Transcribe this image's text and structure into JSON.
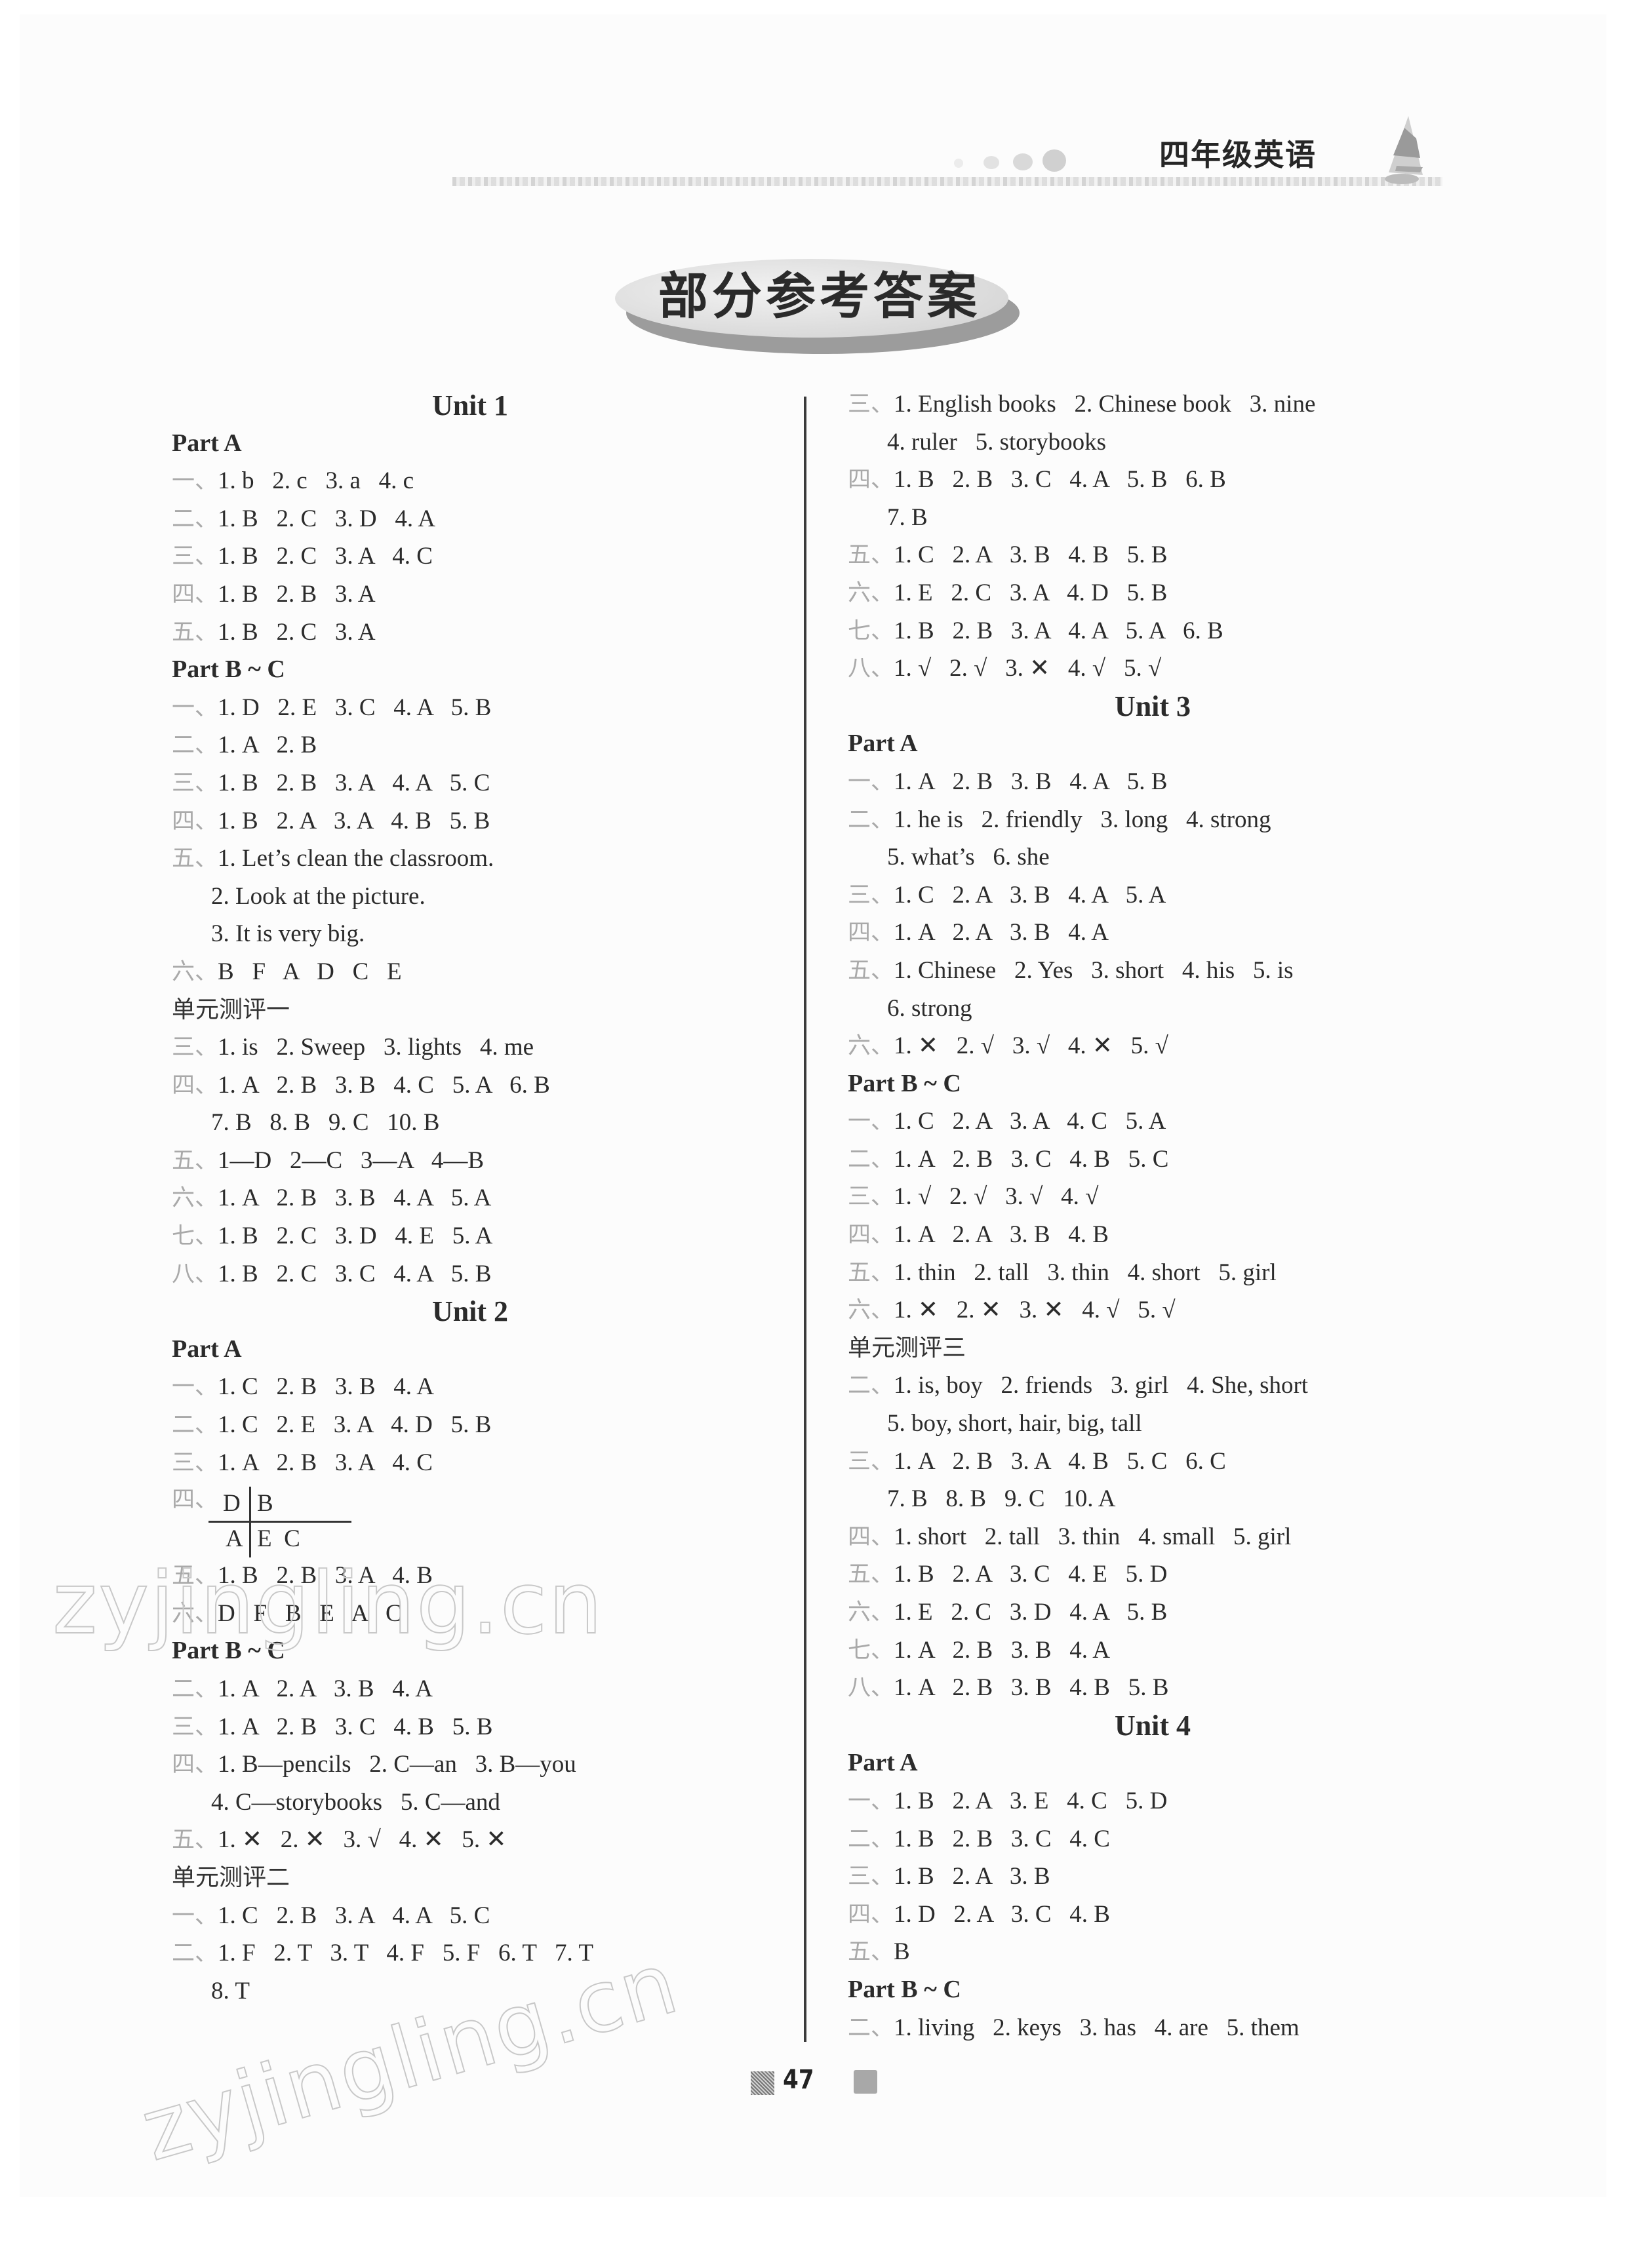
{
  "header": {
    "title": "四年级英语",
    "icon": "sailboat-icon"
  },
  "badge_title": "部分参考答案",
  "page_number": "47",
  "watermark": "zyjingling.cn",
  "left_column": [
    {
      "type": "unit",
      "text": "Unit 1"
    },
    {
      "type": "part",
      "text": "Part A"
    },
    {
      "type": "ans",
      "num": "一、",
      "text": "1. b   2. c   3. a   4. c"
    },
    {
      "type": "ans",
      "num": "二、",
      "text": "1. B   2. C   3. D   4. A"
    },
    {
      "type": "ans",
      "num": "三、",
      "text": "1. B   2. C   3. A   4. C"
    },
    {
      "type": "ans",
      "num": "四、",
      "text": "1. B   2. B   3. A"
    },
    {
      "type": "ans",
      "num": "五、",
      "text": "1. B   2. C   3. A"
    },
    {
      "type": "part",
      "text": "Part B ~ C"
    },
    {
      "type": "ans",
      "num": "一、",
      "text": "1. D   2. E   3. C   4. A   5. B"
    },
    {
      "type": "ans",
      "num": "二、",
      "text": "1. A   2. B"
    },
    {
      "type": "ans",
      "num": "三、",
      "text": "1. B   2. B   3. A   4. A   5. C"
    },
    {
      "type": "ans",
      "num": "四、",
      "text": "1. B   2. A   3. A   4. B   5. B"
    },
    {
      "type": "ans",
      "num": "五、",
      "text": "1. Let’s clean the classroom."
    },
    {
      "type": "cont",
      "text": "2. Look at the picture."
    },
    {
      "type": "cont",
      "text": "3. It is very big."
    },
    {
      "type": "ans",
      "num": "六、",
      "text": "B   F   A   D   C   E"
    },
    {
      "type": "test",
      "text": "单元测评一"
    },
    {
      "type": "ans",
      "num": "三、",
      "text": "1. is   2. Sweep   3. lights   4. me"
    },
    {
      "type": "ans",
      "num": "四、",
      "text": "1. A   2. B   3. B   4. C   5. A   6. B"
    },
    {
      "type": "cont",
      "text": "7. B   8. B   9. C   10. B"
    },
    {
      "type": "ans",
      "num": "五、",
      "text": "1—D   2—C   3—A   4—B"
    },
    {
      "type": "ans",
      "num": "六、",
      "text": "1. A   2. B   3. B   4. A   5. A"
    },
    {
      "type": "ans",
      "num": "七、",
      "text": "1. B   2. C   3. D   4. E   5. A"
    },
    {
      "type": "ans",
      "num": "八、",
      "text": "1. B   2. C   3. C   4. A   5. B"
    },
    {
      "type": "unit",
      "text": "Unit 2"
    },
    {
      "type": "part",
      "text": "Part A"
    },
    {
      "type": "ans",
      "num": "一、",
      "text": "1. C   2. B   3. B   4. A"
    },
    {
      "type": "ans",
      "num": "二、",
      "text": "1. C   2. E   3. A   4. D   5. B"
    },
    {
      "type": "ans",
      "num": "三、",
      "text": "1. A   2. B   3. A   4. C"
    },
    {
      "type": "tchart",
      "num": "四、",
      "top_left": "D",
      "top_right": "B",
      "bottom_left": "A",
      "bottom_right": "E  C"
    },
    {
      "type": "ans",
      "num": "五、",
      "text": "1. B   2. B   3. A   4. B"
    },
    {
      "type": "ans",
      "num": "六、",
      "text": "D   F   B   E   A   C"
    },
    {
      "type": "part",
      "text": "Part B ~ C"
    },
    {
      "type": "ans",
      "num": "二、",
      "text": "1. A   2. A   3. B   4. A"
    },
    {
      "type": "ans",
      "num": "三、",
      "text": "1. A   2. B   3. C   4. B   5. B"
    },
    {
      "type": "ans",
      "num": "四、",
      "text": "1. B—pencils   2. C—an   3. B—you"
    },
    {
      "type": "cont",
      "text": "4. C—storybooks   5. C—and"
    },
    {
      "type": "ans",
      "num": "五、",
      "text": "1. ✕   2. ✕   3. √   4. ✕   5. ✕"
    },
    {
      "type": "test",
      "text": "单元测评二"
    },
    {
      "type": "ans",
      "num": "一、",
      "text": "1. C   2. B   3. A   4. A   5. C"
    },
    {
      "type": "ans",
      "num": "二、",
      "text": "1. F   2. T   3. T   4. F   5. F   6. T   7. T"
    },
    {
      "type": "cont",
      "text": "8. T"
    }
  ],
  "right_column": [
    {
      "type": "ans",
      "num": "三、",
      "text": "1. English books   2. Chinese book   3. nine"
    },
    {
      "type": "cont",
      "text": "4. ruler   5. storybooks"
    },
    {
      "type": "ans",
      "num": "四、",
      "text": "1. B   2. B   3. C   4. A   5. B   6. B"
    },
    {
      "type": "cont",
      "text": "7. B"
    },
    {
      "type": "ans",
      "num": "五、",
      "text": "1. C   2. A   3. B   4. B   5. B"
    },
    {
      "type": "ans",
      "num": "六、",
      "text": "1. E   2. C   3. A   4. D   5. B"
    },
    {
      "type": "ans",
      "num": "七、",
      "text": "1. B   2. B   3. A   4. A   5. A   6. B"
    },
    {
      "type": "ans",
      "num": "八、",
      "text": "1. √   2. √   3. ✕   4. √   5. √"
    },
    {
      "type": "unit",
      "text": "Unit 3"
    },
    {
      "type": "part",
      "text": "Part A"
    },
    {
      "type": "ans",
      "num": "一、",
      "text": "1. A   2. B   3. B   4. A   5. B"
    },
    {
      "type": "ans",
      "num": "二、",
      "text": "1. he is   2. friendly   3. long   4. strong"
    },
    {
      "type": "cont",
      "text": "5. what’s   6. she"
    },
    {
      "type": "ans",
      "num": "三、",
      "text": "1. C   2. A   3. B   4. A   5. A"
    },
    {
      "type": "ans",
      "num": "四、",
      "text": "1. A   2. A   3. B   4. A"
    },
    {
      "type": "ans",
      "num": "五、",
      "text": "1. Chinese   2. Yes   3. short   4. his   5. is"
    },
    {
      "type": "cont",
      "text": "6. strong"
    },
    {
      "type": "ans",
      "num": "六、",
      "text": "1. ✕   2. √   3. √   4. ✕   5. √"
    },
    {
      "type": "part",
      "text": "Part B ~ C"
    },
    {
      "type": "ans",
      "num": "一、",
      "text": "1. C   2. A   3. A   4. C   5. A"
    },
    {
      "type": "ans",
      "num": "二、",
      "text": "1. A   2. B   3. C   4. B   5. C"
    },
    {
      "type": "ans",
      "num": "三、",
      "text": "1. √   2. √   3. √   4. √"
    },
    {
      "type": "ans",
      "num": "四、",
      "text": "1. A   2. A   3. B   4. B"
    },
    {
      "type": "ans",
      "num": "五、",
      "text": "1. thin   2. tall   3. thin   4. short   5. girl"
    },
    {
      "type": "ans",
      "num": "六、",
      "text": "1. ✕   2. ✕   3. ✕   4. √   5. √"
    },
    {
      "type": "test",
      "text": "单元测评三"
    },
    {
      "type": "ans",
      "num": "二、",
      "text": "1. is, boy   2. friends   3. girl   4. She, short"
    },
    {
      "type": "cont",
      "text": "5. boy, short, hair, big, tall"
    },
    {
      "type": "ans",
      "num": "三、",
      "text": "1. A   2. B   3. A   4. B   5. C   6. C"
    },
    {
      "type": "cont",
      "text": "7. B   8. B   9. C   10. A"
    },
    {
      "type": "ans",
      "num": "四、",
      "text": "1. short   2. tall   3. thin   4. small   5. girl"
    },
    {
      "type": "ans",
      "num": "五、",
      "text": "1. B   2. A   3. C   4. E   5. D"
    },
    {
      "type": "ans",
      "num": "六、",
      "text": "1. E   2. C   3. D   4. A   5. B"
    },
    {
      "type": "ans",
      "num": "七、",
      "text": "1. A   2. B   3. B   4. A"
    },
    {
      "type": "ans",
      "num": "八、",
      "text": "1. A   2. B   3. B   4. B   5. B"
    },
    {
      "type": "unit",
      "text": "Unit 4"
    },
    {
      "type": "part",
      "text": "Part A"
    },
    {
      "type": "ans",
      "num": "一、",
      "text": "1. B   2. A   3. E   4. C   5. D"
    },
    {
      "type": "ans",
      "num": "二、",
      "text": "1. B   2. B   3. C   4. C"
    },
    {
      "type": "ans",
      "num": "三、",
      "text": "1. B   2. A   3. B"
    },
    {
      "type": "ans",
      "num": "四、",
      "text": "1. D   2. A   3. C   4. B"
    },
    {
      "type": "ans",
      "num": "五、",
      "text": "B"
    },
    {
      "type": "part",
      "text": "Part B ~ C"
    },
    {
      "type": "ans",
      "num": "二、",
      "text": "1. living   2. keys   3. has   4. are   5. them"
    }
  ]
}
